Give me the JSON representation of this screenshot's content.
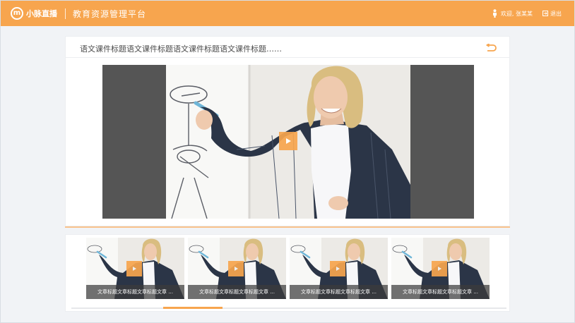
{
  "header": {
    "logo_text": "小脉直播",
    "logo_mark": "m",
    "platform_title": "教育资源管理平台",
    "welcome_text": "欢迎, 张某某",
    "logout_label": "退出"
  },
  "course": {
    "title": "语文课件标题语文课件标题语文课件标题语文课件标题……",
    "back_icon": "return-arrow-icon"
  },
  "player": {
    "play_icon": "play-icon"
  },
  "thumbnails": [
    {
      "caption": "文章标题文章标题文章标题文章 ..."
    },
    {
      "caption": "文章标题文章标题文章标题文章 ..."
    },
    {
      "caption": "文章标题文章标题文章标题文章 ..."
    },
    {
      "caption": "文章标题文章标题文章标题文章 ..."
    }
  ],
  "colors": {
    "accent": "#f7a54e",
    "player_bg": "#555555",
    "page_bg": "#f1f3f6"
  }
}
